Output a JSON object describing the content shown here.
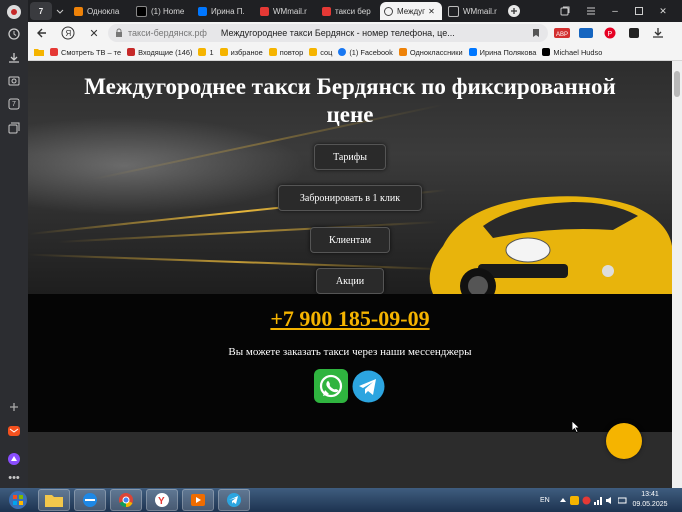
{
  "browser": {
    "sidebar_badge": "7",
    "tabs": [
      {
        "label": "Однокла",
        "color": "#ee8208"
      },
      {
        "label": "(1) Home",
        "color": "#000000"
      },
      {
        "label": "Ирина П.",
        "color": "#0077ff"
      },
      {
        "label": "WMmail.r",
        "color": "#e53935"
      },
      {
        "label": "такси бер",
        "color": "#e53935"
      },
      {
        "label": "Междуг",
        "color": "#444444"
      },
      {
        "label": "WMmail.r",
        "color": "#555555"
      }
    ],
    "tab_count_badge": "7",
    "address": {
      "domain": "такси-бердянск.рф",
      "title": "Междугороднее такси Бердянск - номер телефона, це..."
    },
    "bookmarks": [
      {
        "label": "Смотреть ТВ – те",
        "color": "#e53935"
      },
      {
        "label": "Входящие (146)",
        "color": "#c62828"
      },
      {
        "label": "1",
        "color": "#f5b400"
      },
      {
        "label": "избраное",
        "color": "#f5b400"
      },
      {
        "label": "повтор",
        "color": "#f5b400"
      },
      {
        "label": "соц",
        "color": "#f5b400"
      },
      {
        "label": "(1) Facebook",
        "color": "#1877f2"
      },
      {
        "label": "Одноклассники",
        "color": "#ee8208"
      },
      {
        "label": "Ирина Полякова",
        "color": "#0077ff"
      },
      {
        "label": "Michael Hudso",
        "color": "#000000"
      }
    ]
  },
  "page": {
    "heading": "Междугороднее такси Бердянск по фиксированной цене",
    "buttons": {
      "tariffs": "Тарифы",
      "book": "Забронировать в 1 клик",
      "clients": "Клиентам",
      "promos": "Акции"
    },
    "phone": "+7 900 185-09-09",
    "messenger_text": "Вы можете заказать такси через наши мессенджеры",
    "accent_color": "#f5b400"
  },
  "taskbar": {
    "language": "EN",
    "time": "13:41",
    "date": "09.05.2025"
  }
}
